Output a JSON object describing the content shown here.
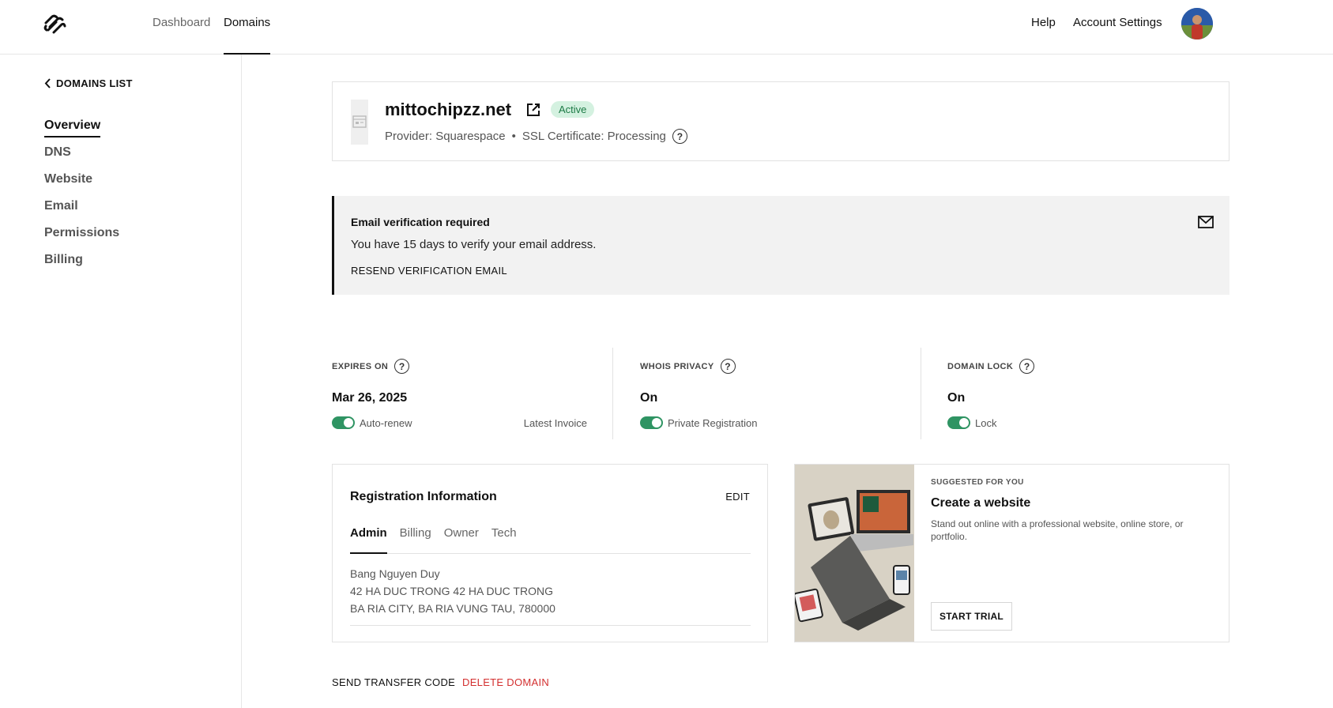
{
  "topnav": {
    "logo": "squarespace-logo",
    "links": [
      {
        "label": "Dashboard"
      },
      {
        "label": "Domains"
      }
    ],
    "help_label": "Help",
    "account_label": "Account Settings"
  },
  "sidebar": {
    "back_label": "DOMAINS LIST",
    "items": [
      {
        "label": "Overview"
      },
      {
        "label": "DNS"
      },
      {
        "label": "Website"
      },
      {
        "label": "Email"
      },
      {
        "label": "Permissions"
      },
      {
        "label": "Billing"
      }
    ]
  },
  "domain": {
    "name": "mittochipzz.net",
    "status": "Active",
    "provider": "Provider: Squarespace",
    "ssl": "SSL Certificate: Processing",
    "separator": "•"
  },
  "verification": {
    "title": "Email verification required",
    "message": "You have 15 days to verify your email address.",
    "action": "RESEND VERIFICATION EMAIL"
  },
  "stats": {
    "expires": {
      "label": "EXPIRES ON",
      "value": "Mar 26, 2025",
      "toggle_label": "Auto-renew",
      "link": "Latest Invoice"
    },
    "privacy": {
      "label": "WHOIS PRIVACY",
      "value": "On",
      "toggle_label": "Private Registration"
    },
    "lock": {
      "label": "DOMAIN LOCK",
      "value": "On",
      "toggle_label": "Lock"
    }
  },
  "registration": {
    "title": "Registration Information",
    "edit_label": "EDIT",
    "tabs": [
      {
        "label": "Admin"
      },
      {
        "label": "Billing"
      },
      {
        "label": "Owner"
      },
      {
        "label": "Tech"
      }
    ],
    "lines": [
      "Bang Nguyen Duy",
      "42 HA DUC TRONG 42 HA DUC TRONG",
      "BA RIA CITY, BA RIA VUNG TAU, 780000"
    ]
  },
  "suggestion": {
    "kicker": "SUGGESTED FOR YOU",
    "title": "Create a website",
    "description": "Stand out online with a professional website, online store, or portfolio.",
    "button": "START TRIAL"
  },
  "actions": {
    "transfer": "SEND TRANSFER CODE",
    "delete": "DELETE DOMAIN"
  },
  "colors": {
    "toggle_on": "#2f9463",
    "active_badge_bg": "#d4f1e0",
    "active_badge_text": "#1c7a45",
    "danger": "#d32f2f",
    "banner_bg": "#f2f2f2"
  }
}
